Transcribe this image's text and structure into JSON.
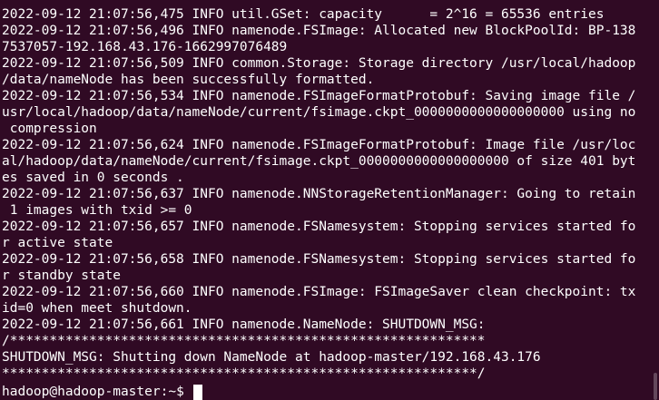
{
  "terminal": {
    "lines": [
      "2022-09-12 21:07:56,475 INFO util.GSet: capacity      = 2^16 = 65536 entries",
      "2022-09-12 21:07:56,496 INFO namenode.FSImage: Allocated new BlockPoolId: BP-138",
      "7537057-192.168.43.176-1662997076489",
      "2022-09-12 21:07:56,509 INFO common.Storage: Storage directory /usr/local/hadoop",
      "/data/nameNode has been successfully formatted.",
      "2022-09-12 21:07:56,534 INFO namenode.FSImageFormatProtobuf: Saving image file /",
      "usr/local/hadoop/data/nameNode/current/fsimage.ckpt_0000000000000000000 using no",
      " compression",
      "2022-09-12 21:07:56,624 INFO namenode.FSImageFormatProtobuf: Image file /usr/loc",
      "al/hadoop/data/nameNode/current/fsimage.ckpt_0000000000000000000 of size 401 byt",
      "es saved in 0 seconds .",
      "2022-09-12 21:07:56,637 INFO namenode.NNStorageRetentionManager: Going to retain",
      " 1 images with txid >= 0",
      "2022-09-12 21:07:56,657 INFO namenode.FSNamesystem: Stopping services started fo",
      "r active state",
      "2022-09-12 21:07:56,658 INFO namenode.FSNamesystem: Stopping services started fo",
      "r standby state",
      "2022-09-12 21:07:56,660 INFO namenode.FSImage: FSImageSaver clean checkpoint: tx",
      "id=0 when meet shutdown.",
      "2022-09-12 21:07:56,661 INFO namenode.NameNode: SHUTDOWN_MSG:",
      "/************************************************************",
      "SHUTDOWN_MSG: Shutting down NameNode at hadoop-master/192.168.43.176",
      "************************************************************/"
    ],
    "prompt": {
      "user_host": "hadoop@hadoop-master",
      "separator": ":",
      "path": "~",
      "symbol": "$"
    }
  },
  "colors": {
    "background": "#300a24",
    "foreground": "#ffffff"
  }
}
